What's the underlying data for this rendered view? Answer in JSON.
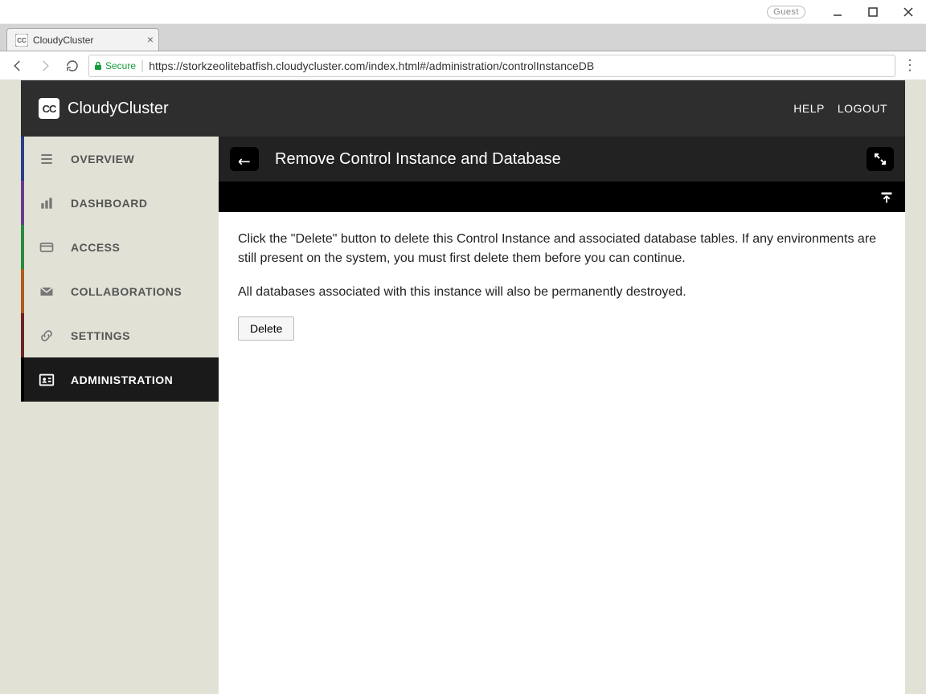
{
  "window": {
    "guest_label": "Guest"
  },
  "browser": {
    "tab_title": "CloudyCluster",
    "secure_label": "Secure",
    "url": "https://storkzeolitebatfish.cloudycluster.com/index.html#/administration/controlInstanceDB"
  },
  "header": {
    "brand": "CloudyCluster",
    "help": "HELP",
    "logout": "LOGOUT"
  },
  "sidebar": {
    "items": [
      {
        "label": "OVERVIEW"
      },
      {
        "label": "DASHBOARD"
      },
      {
        "label": "ACCESS"
      },
      {
        "label": "COLLABORATIONS"
      },
      {
        "label": "SETTINGS"
      },
      {
        "label": "ADMINISTRATION"
      }
    ]
  },
  "page": {
    "title": "Remove Control Instance and Database",
    "paragraph1": "Click the \"Delete\" button to delete this Control Instance and associated database tables. If any environments are still present on the system, you must first delete them before you can continue.",
    "paragraph2": "All databases associated with this instance will also be permanently destroyed.",
    "delete_label": "Delete"
  }
}
